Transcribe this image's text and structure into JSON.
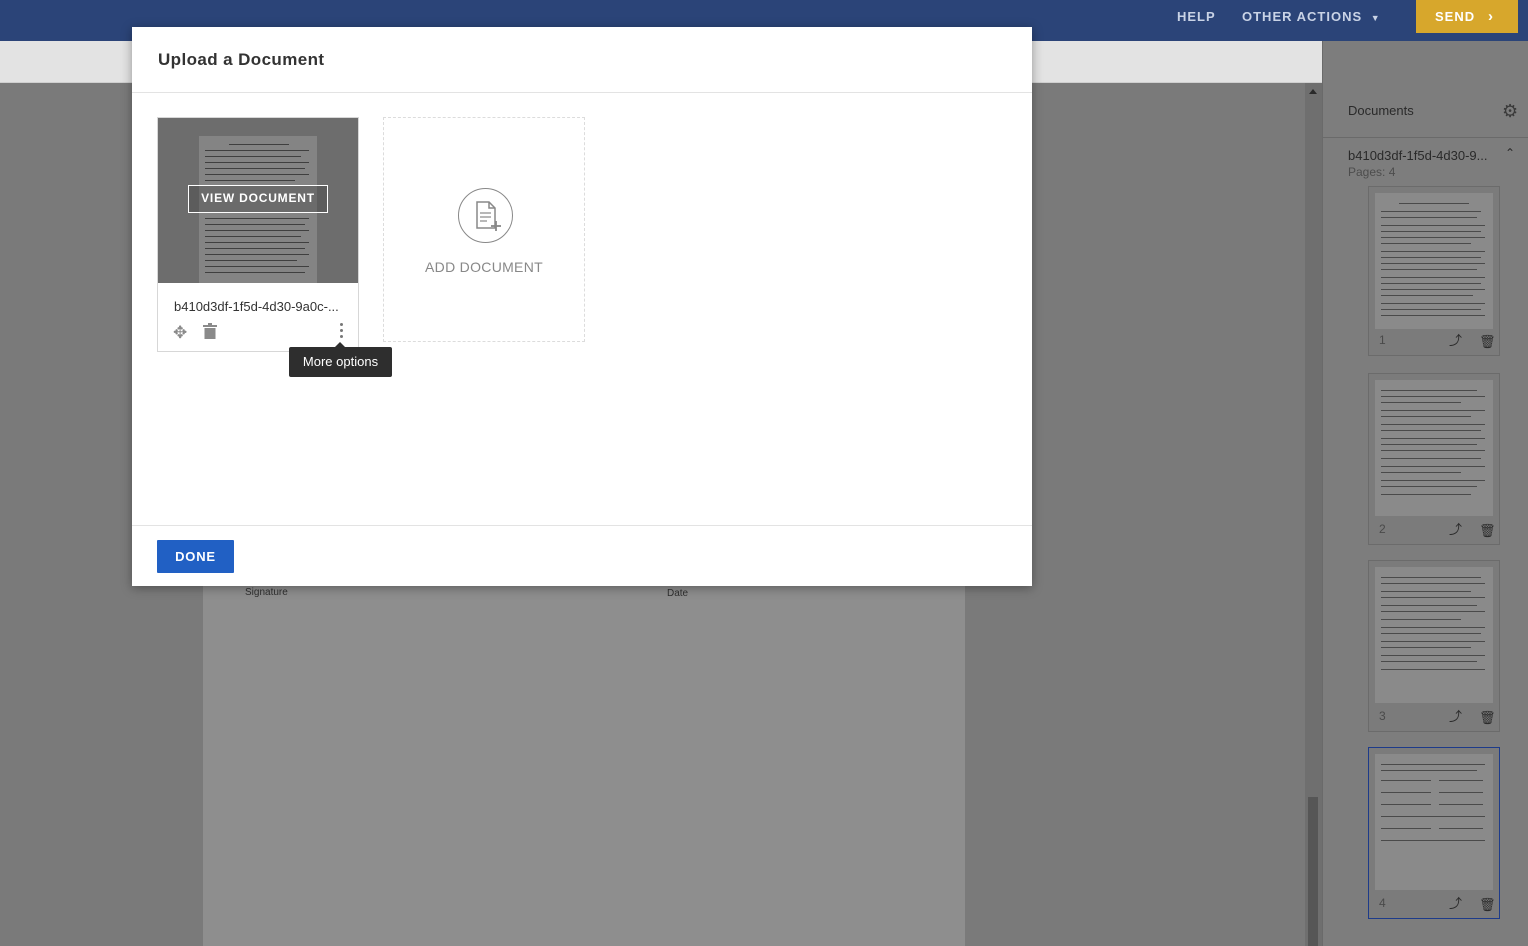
{
  "topbar": {
    "help_label": "HELP",
    "other_actions_label": "OTHER ACTIONS",
    "other_actions_caret": "▼",
    "send_label": "SEND",
    "send_chevron": "›",
    "send_color": "#d7a72c",
    "bar_color": "#2b4478"
  },
  "page": {
    "signature_label": "Signature",
    "date_label": "Date"
  },
  "documents_panel": {
    "title": "Documents",
    "gear_icon": "gear-icon",
    "document_name": "b410d3df-1f5d-4d30-9...",
    "pages_label": "Pages: 4",
    "thumbnails": [
      {
        "page": "1",
        "selected": false
      },
      {
        "page": "2",
        "selected": false
      },
      {
        "page": "3",
        "selected": false
      },
      {
        "page": "4",
        "selected": true
      }
    ]
  },
  "modal": {
    "title": "Upload a Document",
    "document_card": {
      "view_button": "VIEW DOCUMENT",
      "file_name": "b410d3df-1f5d-4d30-9a0c-...",
      "move_icon": "move-icon",
      "trash_icon": "trash-icon",
      "more_icon": "more-options-icon"
    },
    "tooltip": "More options",
    "add_document_label": "ADD DOCUMENT",
    "done_label": "DONE",
    "done_color": "#2160c4"
  }
}
